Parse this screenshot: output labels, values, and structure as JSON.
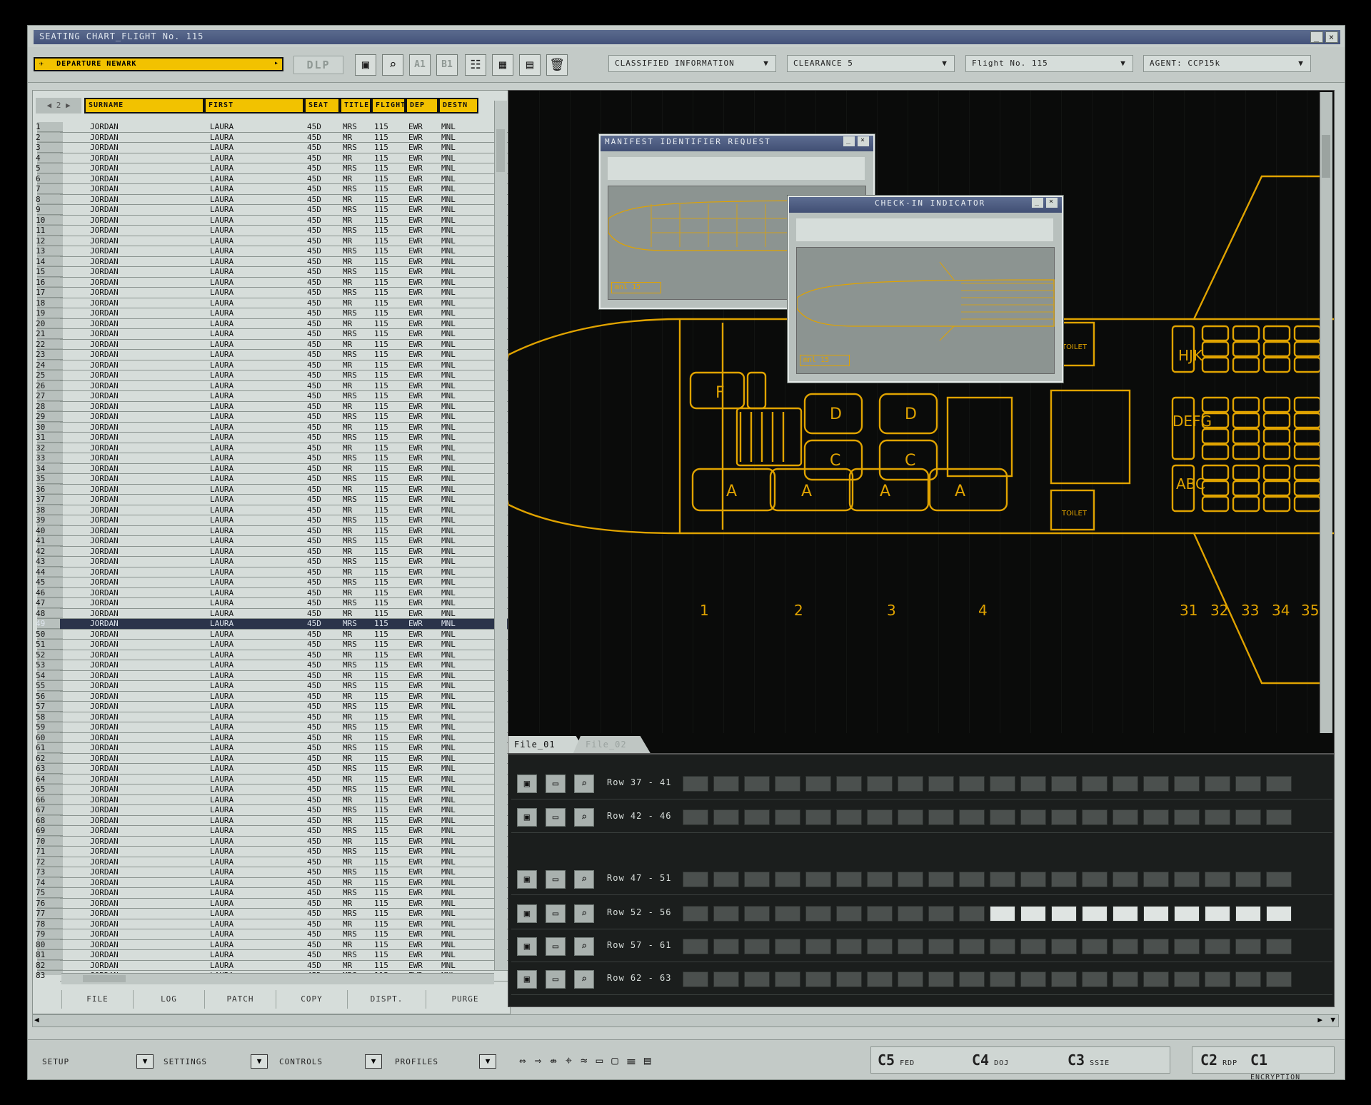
{
  "window": {
    "title": "SEATING CHART_FLIGHT No. 115",
    "minimize": "_",
    "close": "×"
  },
  "toolbar": {
    "departure": "DEPARTURE NEWARK",
    "dlp": "DLP",
    "a1": "A1",
    "b1": "B1",
    "dropdowns": [
      "CLASSIFIED INFORMATION",
      "CLEARANCE 5",
      "Flight No. 115",
      "AGENT: CCP15k"
    ]
  },
  "table": {
    "page": "2",
    "columns": [
      "SURNAME",
      "FIRST",
      "SEAT",
      "TITLE",
      "FLIGHT",
      "DEP",
      "DESTN"
    ],
    "surname": "JORDAN",
    "first": "LAURA",
    "seat": "45D",
    "title_odd": "MRS",
    "title_even": "MR",
    "flight": "115",
    "dep": "EWR",
    "destn": "MNL",
    "row_count": 83,
    "selected_row": 49,
    "bottom_buttons": [
      "FILE",
      "LOG",
      "PATCH",
      "COPY",
      "DISPT.",
      "PURGE"
    ]
  },
  "seatmap": {
    "row_numbers": [
      "1",
      "2",
      "3",
      "4",
      "31",
      "32",
      "33",
      "34",
      "35"
    ],
    "seat_letters": [
      "F",
      "D",
      "D",
      "C",
      "C",
      "A",
      "A",
      "A",
      "A",
      "HJK",
      "DEFG",
      "ABC"
    ],
    "toilet": "TOILET",
    "tabs": [
      "File_01",
      "File_02"
    ]
  },
  "dialogs": {
    "manifest": {
      "title": "MANIFEST IDENTIFIER REQUEST",
      "field": "mnl 15"
    },
    "checkin": {
      "title": "CHECK-IN INDICATOR",
      "field": "mnl 15"
    }
  },
  "row_groups": [
    {
      "label": "Row 37 - 41",
      "lit": 0
    },
    {
      "label": "Row 42 - 46",
      "lit": 0
    },
    {
      "label": "Row 47 - 51",
      "lit": 0
    },
    {
      "label": "Row 52 - 56",
      "lit": 10
    },
    {
      "label": "Row 57 - 61",
      "lit": 0
    },
    {
      "label": "Row 62 - 63",
      "lit": 0
    }
  ],
  "statusbar": {
    "menus": [
      "SETUP",
      "SETTINGS",
      "CONTROLS",
      "PROFILES"
    ],
    "channels": [
      {
        "code": "C5",
        "label": "FED"
      },
      {
        "code": "C4",
        "label": "DOJ"
      },
      {
        "code": "C3",
        "label": "SSIE"
      },
      {
        "code": "C2",
        "label": "RDP"
      },
      {
        "code": "C1",
        "label": "ENCRYPTION"
      }
    ]
  },
  "colors": {
    "accent": "#e0a300",
    "header": "#f2c200",
    "titlebar": "#4b5b82",
    "panel": "#c8cfcc"
  }
}
